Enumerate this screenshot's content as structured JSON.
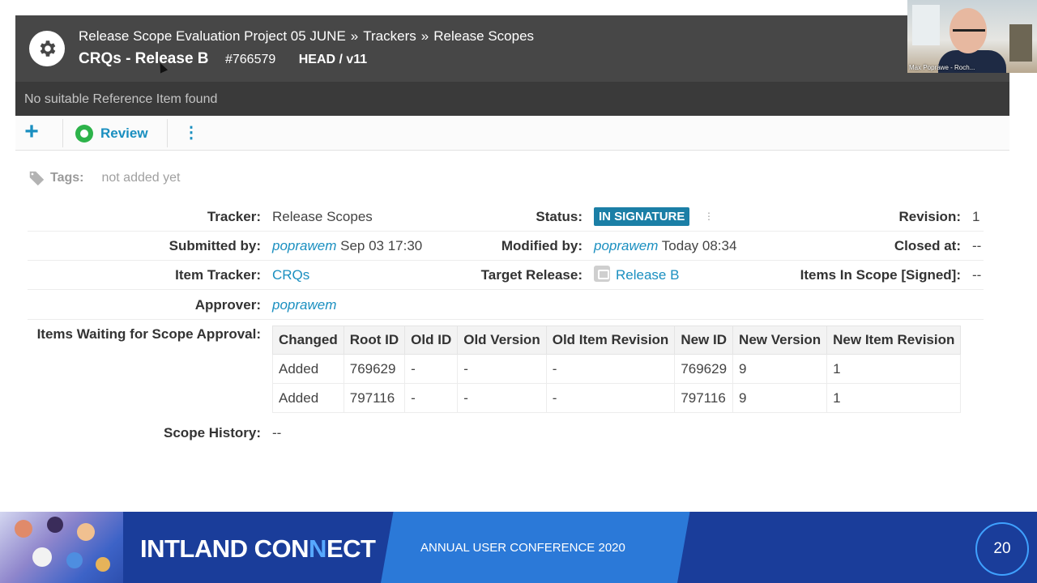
{
  "header": {
    "breadcrumb": {
      "project": "Release Scope Evaluation Project 05 JUNE",
      "separator": "»",
      "trackers": "Trackers",
      "tracker": "Release Scopes"
    },
    "title": "CRQs - Release B",
    "item_id": "#766579",
    "version": "HEAD / v11",
    "reference_message": "No suitable Reference Item found"
  },
  "toolbar": {
    "add_icon": "plus-icon",
    "review_label": "Review",
    "more_icon": "kebab-menu-icon"
  },
  "tags": {
    "label": "Tags:",
    "value": "not added yet"
  },
  "fields": {
    "tracker_label": "Tracker:",
    "tracker_value": "Release Scopes",
    "status_label": "Status:",
    "status_value": "IN SIGNATURE",
    "revision_label": "Revision:",
    "revision_value": "1",
    "submitted_label": "Submitted by:",
    "submitted_user": "poprawem",
    "submitted_date": "Sep 03 17:30",
    "modified_label": "Modified by:",
    "modified_user": "poprawem",
    "modified_date": "Today 08:34",
    "closed_label": "Closed at:",
    "closed_value": "--",
    "item_tracker_label": "Item Tracker:",
    "item_tracker_value": "CRQs",
    "target_release_label": "Target Release:",
    "target_release_value": "Release B",
    "items_in_scope_label": "Items In Scope [Signed]:",
    "items_in_scope_value": "--",
    "approver_label": "Approver:",
    "approver_value": "poprawem",
    "waiting_label": "Items Waiting for Scope Approval:",
    "scope_history_label": "Scope History:",
    "scope_history_value": "--"
  },
  "scope_table": {
    "headers": [
      "Changed",
      "Root ID",
      "Old ID",
      "Old Version",
      "Old Item Revision",
      "New ID",
      "New Version",
      "New Item Revision"
    ],
    "rows": [
      [
        "Added",
        "769629",
        "-",
        "-",
        "-",
        "769629",
        "9",
        "1"
      ],
      [
        "Added",
        "797116",
        "-",
        "-",
        "-",
        "797116",
        "9",
        "1"
      ]
    ]
  },
  "webcam": {
    "name": "Max Poprawe - Roch..."
  },
  "footer": {
    "brand_a": "INTLAND CON",
    "brand_b": "N",
    "brand_c": "ECT",
    "conference": "ANNUAL USER CONFERENCE 2020",
    "page_number": "20"
  },
  "colors": {
    "accent": "#1a8fc0",
    "status_badge": "#1b7fa6",
    "header_bg": "#474747",
    "footer_bg": "#1a3d9a"
  }
}
